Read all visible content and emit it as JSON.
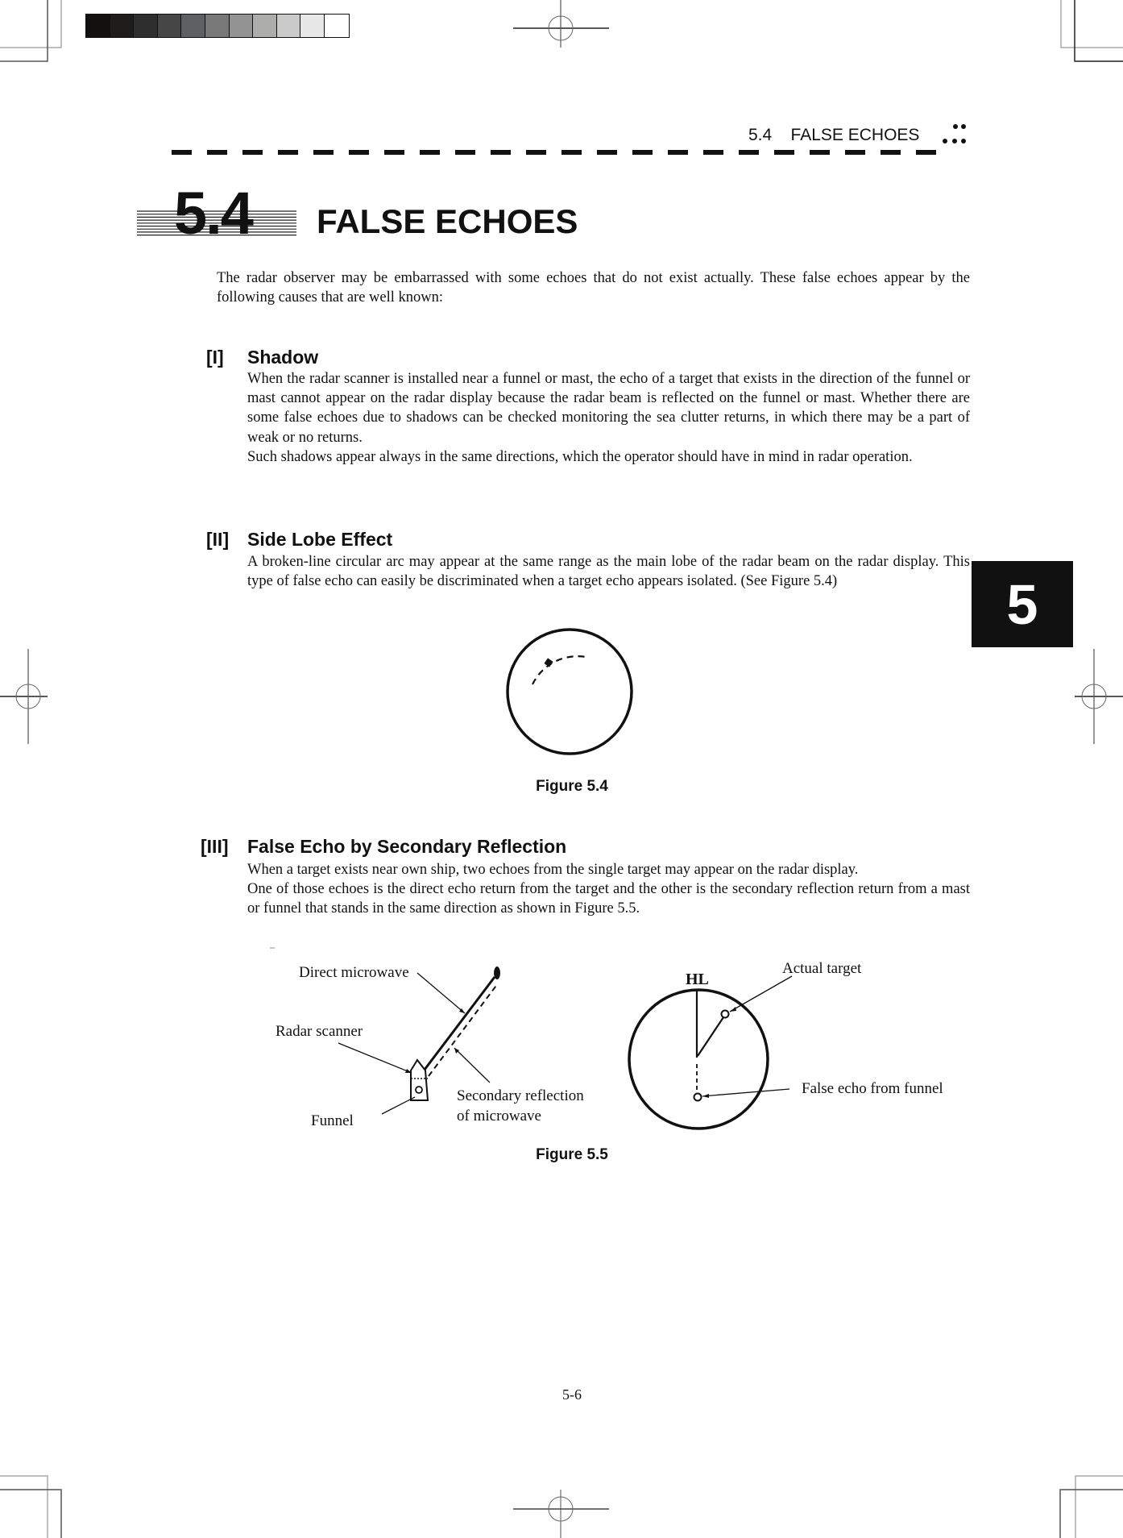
{
  "running_header": {
    "section": "5.4",
    "title": "FALSE ECHOES"
  },
  "chapter_tab": "5",
  "title": {
    "number": "5.4",
    "text": "FALSE ECHOES"
  },
  "intro": "The radar observer may be embarrassed with some echoes that do not exist actually.  These false echoes appear by the following causes that are well known:",
  "sections": [
    {
      "num": "[I]",
      "heading": "Shadow",
      "paragraphs": [
        "When the radar scanner is installed near a funnel or mast, the echo of a target that exists in the direction of the funnel or mast cannot appear on the radar display because the radar beam is reflected on the funnel or mast.   Whether there are some false echoes due to shadows can be checked monitoring the sea clutter returns, in which there may be a part of weak or no returns.",
        "Such shadows appear always in the same directions, which the operator should have in mind in radar operation."
      ]
    },
    {
      "num": "[II]",
      "heading": "Side Lobe Effect",
      "paragraphs": [
        "A broken-line circular arc may appear at the same range as the main lobe of the radar beam on the radar display.   This type of false echo can easily be discriminated when a target echo appears isolated.   (See Figure 5.4)"
      ]
    },
    {
      "num": "[III]",
      "heading": "False Echo by Secondary Reflection",
      "paragraphs": [
        "When a target exists near own ship, two echoes from the single target may appear on the radar display.",
        "One of those echoes is the direct echo return from the target and the other is the secondary reflection return from a mast or funnel that stands in the same direction as shown in Figure 5.5."
      ]
    }
  ],
  "figure_5_4": {
    "caption": "Figure 5.4"
  },
  "figure_5_5": {
    "caption": "Figure 5.5",
    "labels": {
      "direct_microwave": "Direct microwave",
      "radar_scanner": "Radar scanner",
      "funnel": "Funnel",
      "secondary_reflection_line1": "Secondary reflection",
      "secondary_reflection_line2": "of microwave",
      "hl": "HL",
      "actual_target": "Actual target",
      "false_echo": "False echo from funnel"
    }
  },
  "page_number": "5-6",
  "gray_scale": [
    "#121110",
    "#1e1d1b",
    "#2e2e2e",
    "#464646",
    "#5f6061",
    "#79797a",
    "#939393",
    "#adadac",
    "#cbcaca",
    "#e7e7e7",
    "#ffffff"
  ]
}
